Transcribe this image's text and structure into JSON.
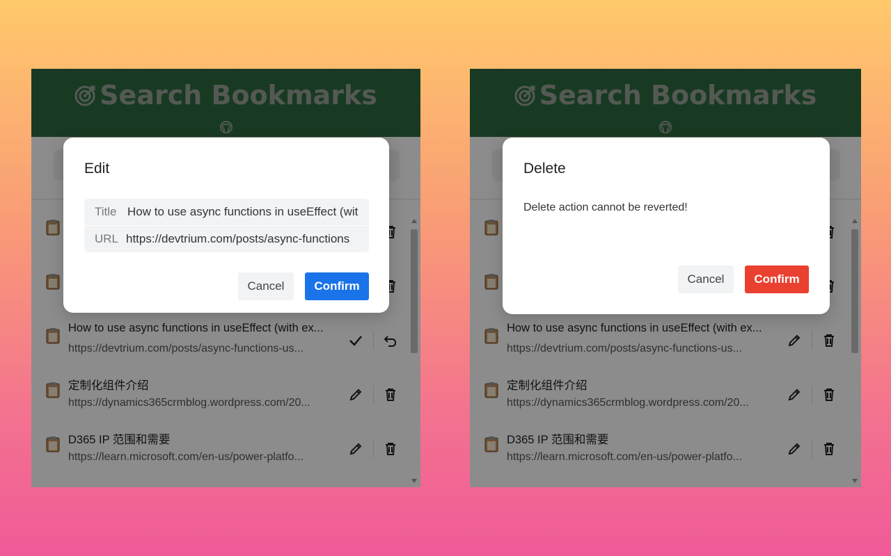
{
  "app": {
    "title": "Search Bookmarks",
    "colors": {
      "header_bg": "#2e6b3f",
      "title_text": "#9aa39a",
      "confirm_blue": "#1a73e8",
      "confirm_red": "#e94030"
    }
  },
  "left_panel": {
    "bookmarks": [
      {
        "title": "",
        "url": "",
        "action1_icon": "pencil-icon",
        "action2_icon": "trash-icon"
      },
      {
        "title": "",
        "url": "",
        "action1_icon": "pencil-icon",
        "action2_icon": "trash-icon"
      },
      {
        "title": "How to use async functions in useEffect (with ex...",
        "url": "https://devtrium.com/posts/async-functions-us...",
        "action1_icon": "check-icon",
        "action2_icon": "undo-icon"
      },
      {
        "title": "定制化组件介绍",
        "url": "https://dynamics365crmblog.wordpress.com/20...",
        "action1_icon": "pencil-icon",
        "action2_icon": "trash-icon"
      },
      {
        "title": "D365 IP 范围和需要",
        "url": "https://learn.microsoft.com/en-us/power-platfo...",
        "action1_icon": "pencil-icon",
        "action2_icon": "trash-icon"
      }
    ],
    "modal": {
      "title": "Edit",
      "fields": {
        "title_label": "Title",
        "title_value": "How to use async functions in useEffect (wit",
        "url_label": "URL",
        "url_value": "https://devtrium.com/posts/async-functions"
      },
      "cancel_label": "Cancel",
      "confirm_label": "Confirm"
    }
  },
  "right_panel": {
    "bookmarks": [
      {
        "title": "",
        "url": "",
        "action1_icon": "pencil-icon",
        "action2_icon": "trash-icon"
      },
      {
        "title": "",
        "url": "",
        "action1_icon": "pencil-icon",
        "action2_icon": "trash-icon"
      },
      {
        "title": "How to use async functions in useEffect (with ex...",
        "url": "https://devtrium.com/posts/async-functions-us...",
        "action1_icon": "pencil-icon",
        "action2_icon": "trash-icon"
      },
      {
        "title": "定制化组件介绍",
        "url": "https://dynamics365crmblog.wordpress.com/20...",
        "action1_icon": "pencil-icon",
        "action2_icon": "trash-icon"
      },
      {
        "title": "D365 IP 范围和需要",
        "url": "https://learn.microsoft.com/en-us/power-platfo...",
        "action1_icon": "pencil-icon",
        "action2_icon": "trash-icon"
      }
    ],
    "modal": {
      "title": "Delete",
      "message": "Delete action cannot be reverted!",
      "cancel_label": "Cancel",
      "confirm_label": "Confirm"
    }
  }
}
